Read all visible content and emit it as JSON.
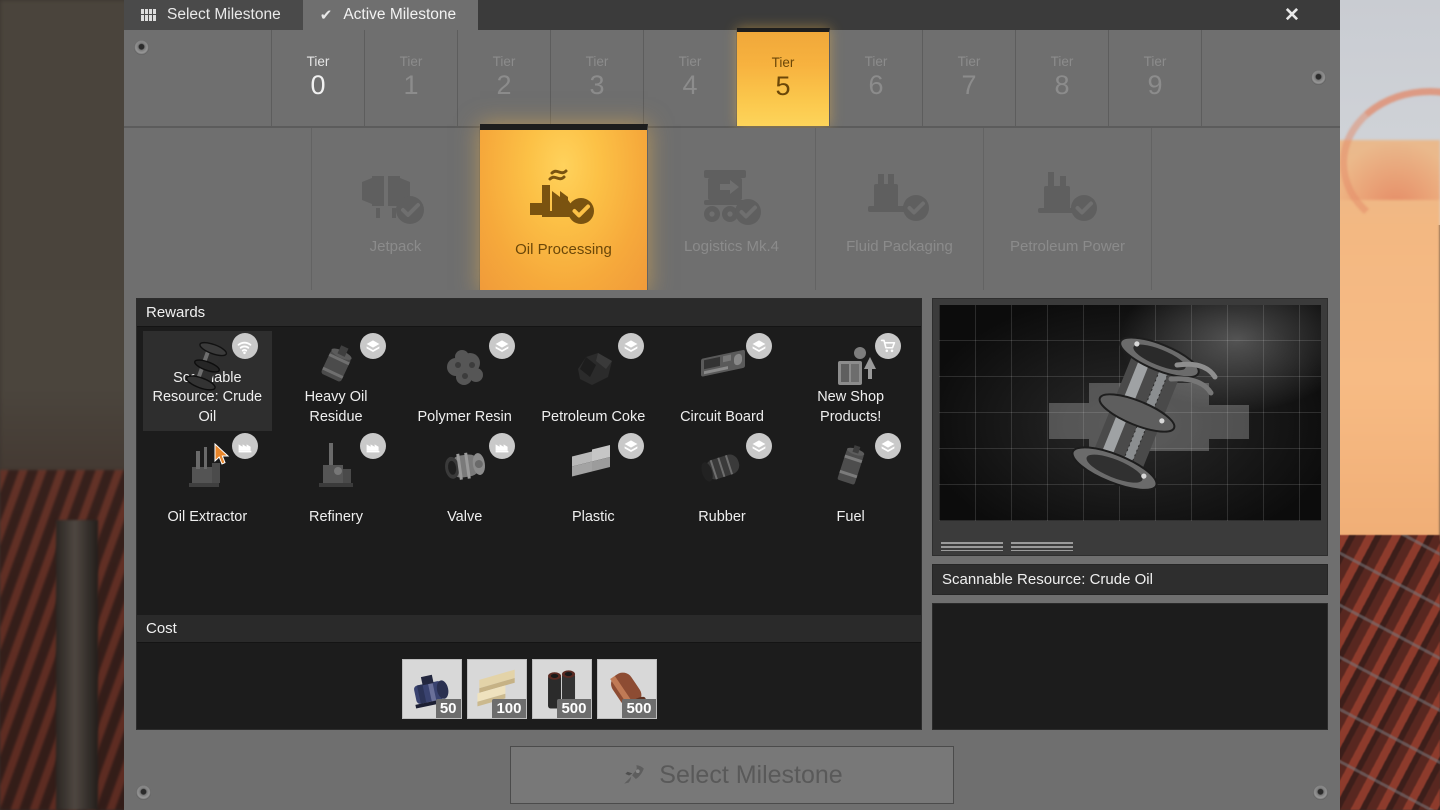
{
  "window": {
    "close_label": "✕"
  },
  "tabs": [
    {
      "label": "Select Milestone",
      "icon": "grid-icon",
      "active": false
    },
    {
      "label": "Active Milestone",
      "icon": "check-icon",
      "active": true
    }
  ],
  "tiers": {
    "label_prefix": "Tier",
    "items": [
      {
        "label": "Tier",
        "number": "0",
        "state": "unlocked"
      },
      {
        "label": "Tier",
        "number": "1",
        "state": "locked"
      },
      {
        "label": "Tier",
        "number": "2",
        "state": "locked"
      },
      {
        "label": "Tier",
        "number": "3",
        "state": "locked"
      },
      {
        "label": "Tier",
        "number": "4",
        "state": "locked"
      },
      {
        "label": "Tier",
        "number": "5",
        "state": "selected"
      },
      {
        "label": "Tier",
        "number": "6",
        "state": "locked"
      },
      {
        "label": "Tier",
        "number": "7",
        "state": "locked"
      },
      {
        "label": "Tier",
        "number": "8",
        "state": "locked"
      },
      {
        "label": "Tier",
        "number": "9",
        "state": "locked"
      }
    ]
  },
  "milestones": [
    {
      "label": "Jetpack",
      "icon": "jetpack-icon",
      "selected": false
    },
    {
      "label": "Oil Processing",
      "icon": "oil-refinery-icon",
      "selected": true
    },
    {
      "label": "Logistics Mk.4",
      "icon": "conveyor-icon",
      "selected": false
    },
    {
      "label": "Fluid Packaging",
      "icon": "packager-icon",
      "selected": false
    },
    {
      "label": "Petroleum Power",
      "icon": "generator-icon",
      "selected": false
    }
  ],
  "rewards": {
    "header": "Rewards",
    "items": [
      {
        "name": "Scannable Resource: Crude Oil",
        "badge": "scanner-icon",
        "highlighted": true
      },
      {
        "name": "Heavy Oil Residue",
        "badge": "item-icon",
        "highlighted": false
      },
      {
        "name": "Polymer Resin",
        "badge": "item-icon",
        "highlighted": false
      },
      {
        "name": "Petroleum Coke",
        "badge": "item-icon",
        "highlighted": false
      },
      {
        "name": "Circuit Board",
        "badge": "item-icon",
        "highlighted": false
      },
      {
        "name": "New Shop Products!",
        "badge": "shop-cart-icon",
        "highlighted": false
      },
      {
        "name": "Oil Extractor",
        "badge": "building-icon",
        "highlighted": false
      },
      {
        "name": "Refinery",
        "badge": "building-icon",
        "highlighted": false
      },
      {
        "name": "Valve",
        "badge": "building-icon",
        "highlighted": false
      },
      {
        "name": "Plastic",
        "badge": "item-icon",
        "highlighted": false
      },
      {
        "name": "Rubber",
        "badge": "item-icon",
        "highlighted": false
      },
      {
        "name": "Fuel",
        "badge": "item-icon",
        "highlighted": false
      }
    ]
  },
  "cost": {
    "header": "Cost",
    "items": [
      {
        "name": "Motor",
        "qty": "50",
        "color": "#3c4166"
      },
      {
        "name": "Beam",
        "qty": "100",
        "color": "#d8c79a"
      },
      {
        "name": "Steel Pipe",
        "qty": "500",
        "color": "#2a2422"
      },
      {
        "name": "Copper Sheet",
        "qty": "500",
        "color": "#8e4a34"
      }
    ]
  },
  "preview": {
    "title": "Scannable Resource: Crude Oil",
    "description": ""
  },
  "footer": {
    "select_button": "Select Milestone",
    "select_icon": "rocket-icon"
  },
  "colors": {
    "accent": "#f7b23f",
    "panel": "#6f6f6f",
    "dark_panel": "#1c1c1c"
  }
}
